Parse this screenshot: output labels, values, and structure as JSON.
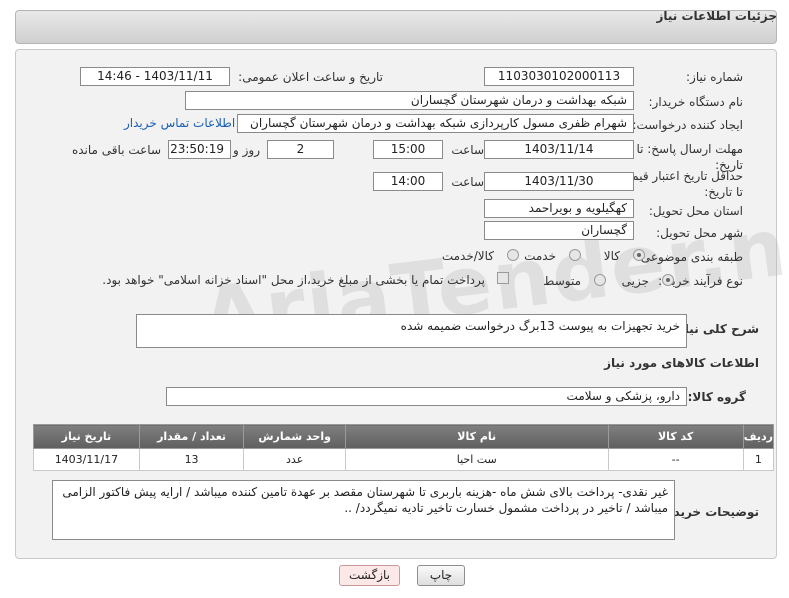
{
  "header": {
    "title": "جزئیات اطلاعات نیاز"
  },
  "form": {
    "need_number": {
      "label": "شماره نیاز:",
      "value": "1103030102000113"
    },
    "announce": {
      "label": "تاریخ و ساعت اعلان عمومی:",
      "value": "1403/11/11 - 14:46"
    },
    "buyer_org": {
      "label": "نام دستگاه خریدار:",
      "value": "شبکه بهداشت و درمان شهرستان گچساران"
    },
    "requester": {
      "label": "ایجاد کننده درخواست:",
      "value": "شهرام ظفری مسول کارپردازی  شبکه بهداشت و درمان شهرستان گچساران",
      "contact_link": "اطلاعات تماس خریدار"
    },
    "deadline": {
      "label": "مهلت ارسال پاسخ: تا تاریخ:",
      "date": "1403/11/14",
      "time_label": "ساعت",
      "time": "15:00",
      "days": "2",
      "days_label": "روز و",
      "remaining": "23:50:19",
      "remaining_label": "ساعت باقی مانده"
    },
    "validity": {
      "label": "حداقل تاریخ اعتبار قیمت: تا تاریخ:",
      "date": "1403/11/30",
      "time_label": "ساعت",
      "time": "14:00"
    },
    "province": {
      "label": "استان محل تحویل:",
      "value": "کهگیلویه و بویراحمد"
    },
    "city": {
      "label": "شهر محل تحویل:",
      "value": "گچساران"
    },
    "category": {
      "label": "طبقه بندی موضوعی:",
      "options": [
        "کالا",
        "خدمت",
        "کالا/خدمت"
      ],
      "selected": "کالا"
    },
    "process": {
      "label": "نوع فرآیند خرید :",
      "options": [
        "جزیی",
        "متوسط"
      ],
      "selected": "جزیی",
      "note": "پرداخت تمام یا بخشی از مبلغ خرید،از محل \"اسناد خزانه اسلامی\" خواهد بود."
    }
  },
  "description": {
    "label": "شرح کلی نیاز:",
    "value": "خرید  تجهیزات به پیوست 13برگ درخواست ضمیمه شده"
  },
  "goods_section": {
    "title": "اطلاعات کالاهای مورد نیاز"
  },
  "goods_group": {
    "label": "گروه کالا:",
    "value": "دارو، پزشکی و سلامت"
  },
  "table": {
    "headers": [
      "ردیف",
      "کد کالا",
      "نام کالا",
      "واحد شمارش",
      "تعداد / مقدار",
      "تاریخ نیاز"
    ],
    "rows": [
      [
        "1",
        "--",
        "ست احیا",
        "عدد",
        "13",
        "1403/11/17"
      ]
    ]
  },
  "buyer_notes": {
    "label": "توضیحات خریدار:",
    "value": "غیر نقدی- پرداخت بالای شش ماه -هزینه باربری تا شهرستان مقصد بر عهدة تامین کننده میباشد / ارایه پیش فاکتور الزامی میباشد / تاخیر در پرداخت مشمول خسارت تاخیر تادیه نمیگردد/ .."
  },
  "buttons": {
    "print": "چاپ",
    "back": "بازگشت"
  },
  "watermark": "AriaTender.net"
}
